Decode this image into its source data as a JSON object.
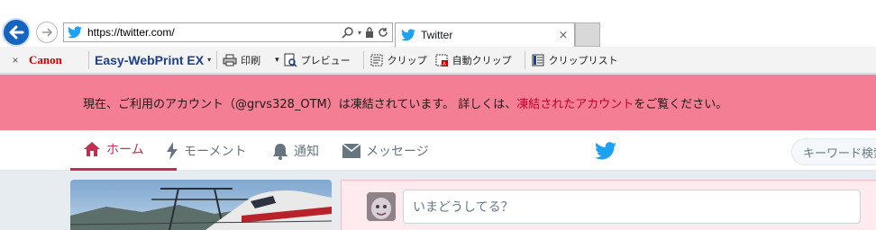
{
  "browser": {
    "url": "https://twitter.com/",
    "tab_title": "Twitter",
    "tab_close": "×"
  },
  "toolbar": {
    "close": "×",
    "brand": "Canon",
    "app_name": "Easy-WebPrint EX",
    "app_caret": "▾",
    "items": [
      {
        "label": "印刷",
        "icon": "printer-icon"
      },
      {
        "label": "プレビュー",
        "icon": "preview-icon"
      },
      {
        "label": "クリップ",
        "icon": "clip-icon"
      },
      {
        "label": "自動クリップ",
        "icon": "auto-clip-icon"
      },
      {
        "label": "クリップリスト",
        "icon": "clip-list-icon"
      }
    ],
    "print_caret": "▾"
  },
  "banner": {
    "text_before": "現在、ご利用のアカウント（@grvs328_OTM）は凍結されています。 詳しくは、",
    "link_text": "凍結されたアカウント",
    "text_after": "をご覧ください。"
  },
  "nav": {
    "home": "ホーム",
    "moments": "モーメント",
    "notifications": "通知",
    "messages": "メッセージ"
  },
  "search": {
    "placeholder": "キーワード検索"
  },
  "compose": {
    "placeholder": "いまどうしてる？"
  },
  "colors": {
    "banner": "#f47f94",
    "active_nav": "#c32f4f",
    "twitter_blue": "#1da1f2",
    "compose_bg": "#ffebee"
  }
}
